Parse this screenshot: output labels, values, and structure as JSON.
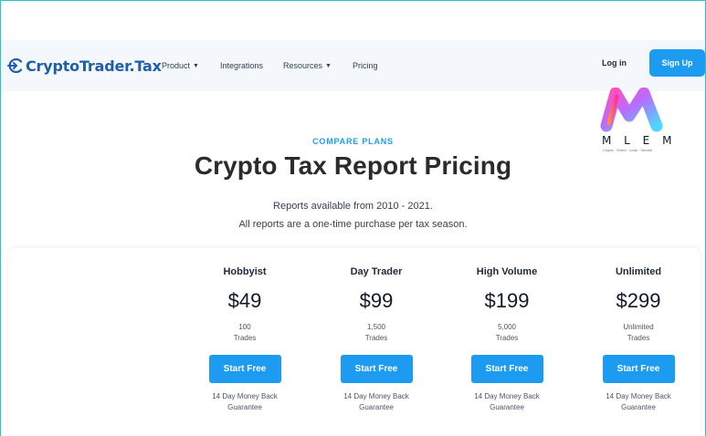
{
  "header": {
    "logo_text": "CryptoTrader.Tax",
    "nav": [
      {
        "label": "Product",
        "has_dropdown": true
      },
      {
        "label": "Integrations",
        "has_dropdown": false
      },
      {
        "label": "Resources",
        "has_dropdown": true
      },
      {
        "label": "Pricing",
        "has_dropdown": false
      }
    ],
    "login_label": "Log in",
    "signup_label": "Sign Up"
  },
  "hero": {
    "eyebrow": "COMPARE PLANS",
    "title": "Crypto Tax Report Pricing",
    "subtitle_line1": "Reports available from 2010 - 2021.",
    "subtitle_line2": "All reports are a one-time purchase per tax season."
  },
  "plans": [
    {
      "name": "Hobbyist",
      "price": "$49",
      "qty": "100",
      "qty_unit": "Trades",
      "button": "Start Free",
      "guarantee_line1": "14 Day Money Back",
      "guarantee_line2": "Guarantee"
    },
    {
      "name": "Day Trader",
      "price": "$99",
      "qty": "1,500",
      "qty_unit": "Trades",
      "button": "Start Free",
      "guarantee_line1": "14 Day Money Back",
      "guarantee_line2": "Guarantee"
    },
    {
      "name": "High Volume",
      "price": "$199",
      "qty": "5,000",
      "qty_unit": "Trades",
      "button": "Start Free",
      "guarantee_line1": "14 Day Money Back",
      "guarantee_line2": "Guarantee"
    },
    {
      "name": "Unlimited",
      "price": "$299",
      "qty": "Unlimited",
      "qty_unit": "Trades",
      "button": "Start Free",
      "guarantee_line1": "14 Day Money Back",
      "guarantee_line2": "Guarantee"
    }
  ],
  "watermark": {
    "text": "M L E M",
    "tagline": "Crypto · Event · Leak · Stream"
  },
  "colors": {
    "accent": "#1d9bf0",
    "brand": "#1f5ea8",
    "header_bg": "#f4f8fc",
    "frame": "#27c3c7"
  },
  "icons": {
    "logo": "cryptotrader-logo-icon",
    "dropdown": "chevron-down-icon"
  }
}
